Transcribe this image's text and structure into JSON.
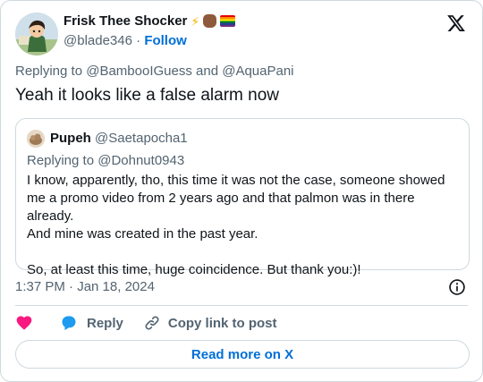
{
  "author": {
    "display_name": "Frisk Thee Shocker",
    "handle": "@blade346",
    "separator": "·",
    "follow_label": "Follow",
    "name_emojis": [
      "lightning-emoji",
      "raised-fist-medium-dark-emoji",
      "rainbow-flag-emoji"
    ]
  },
  "tweet": {
    "replying_prefix": "Replying to",
    "replying_user_1": "@BambooIGuess",
    "replying_and": "and",
    "replying_user_2": "@AquaPani",
    "text": "Yeah it looks like a false alarm now",
    "timestamp": "1:37 PM · Jan 18, 2024"
  },
  "quoted": {
    "display_name": "Pupeh",
    "handle": "@Saetapocha1",
    "replying_prefix": "Replying to",
    "replying_user": "@Dohnut0943",
    "line_1": "I know, apparently, tho, this time it was not the case, someone showed",
    "line_2": "me a promo video from 2 years ago and that palmon was in there already.",
    "line_3": "And mine was created in the past year.",
    "line_4": "So, at least this time, huge coincidence. But thank you:)!"
  },
  "actions": {
    "reply_label": "Reply",
    "copy_label": "Copy link to post",
    "read_more_label": "Read more on X"
  },
  "colors": {
    "link_blue": "#006fd6",
    "heart_red": "#f91880",
    "reply_blue": "#1d9bf0",
    "muted_text": "#536471",
    "border": "#cfd9de"
  }
}
